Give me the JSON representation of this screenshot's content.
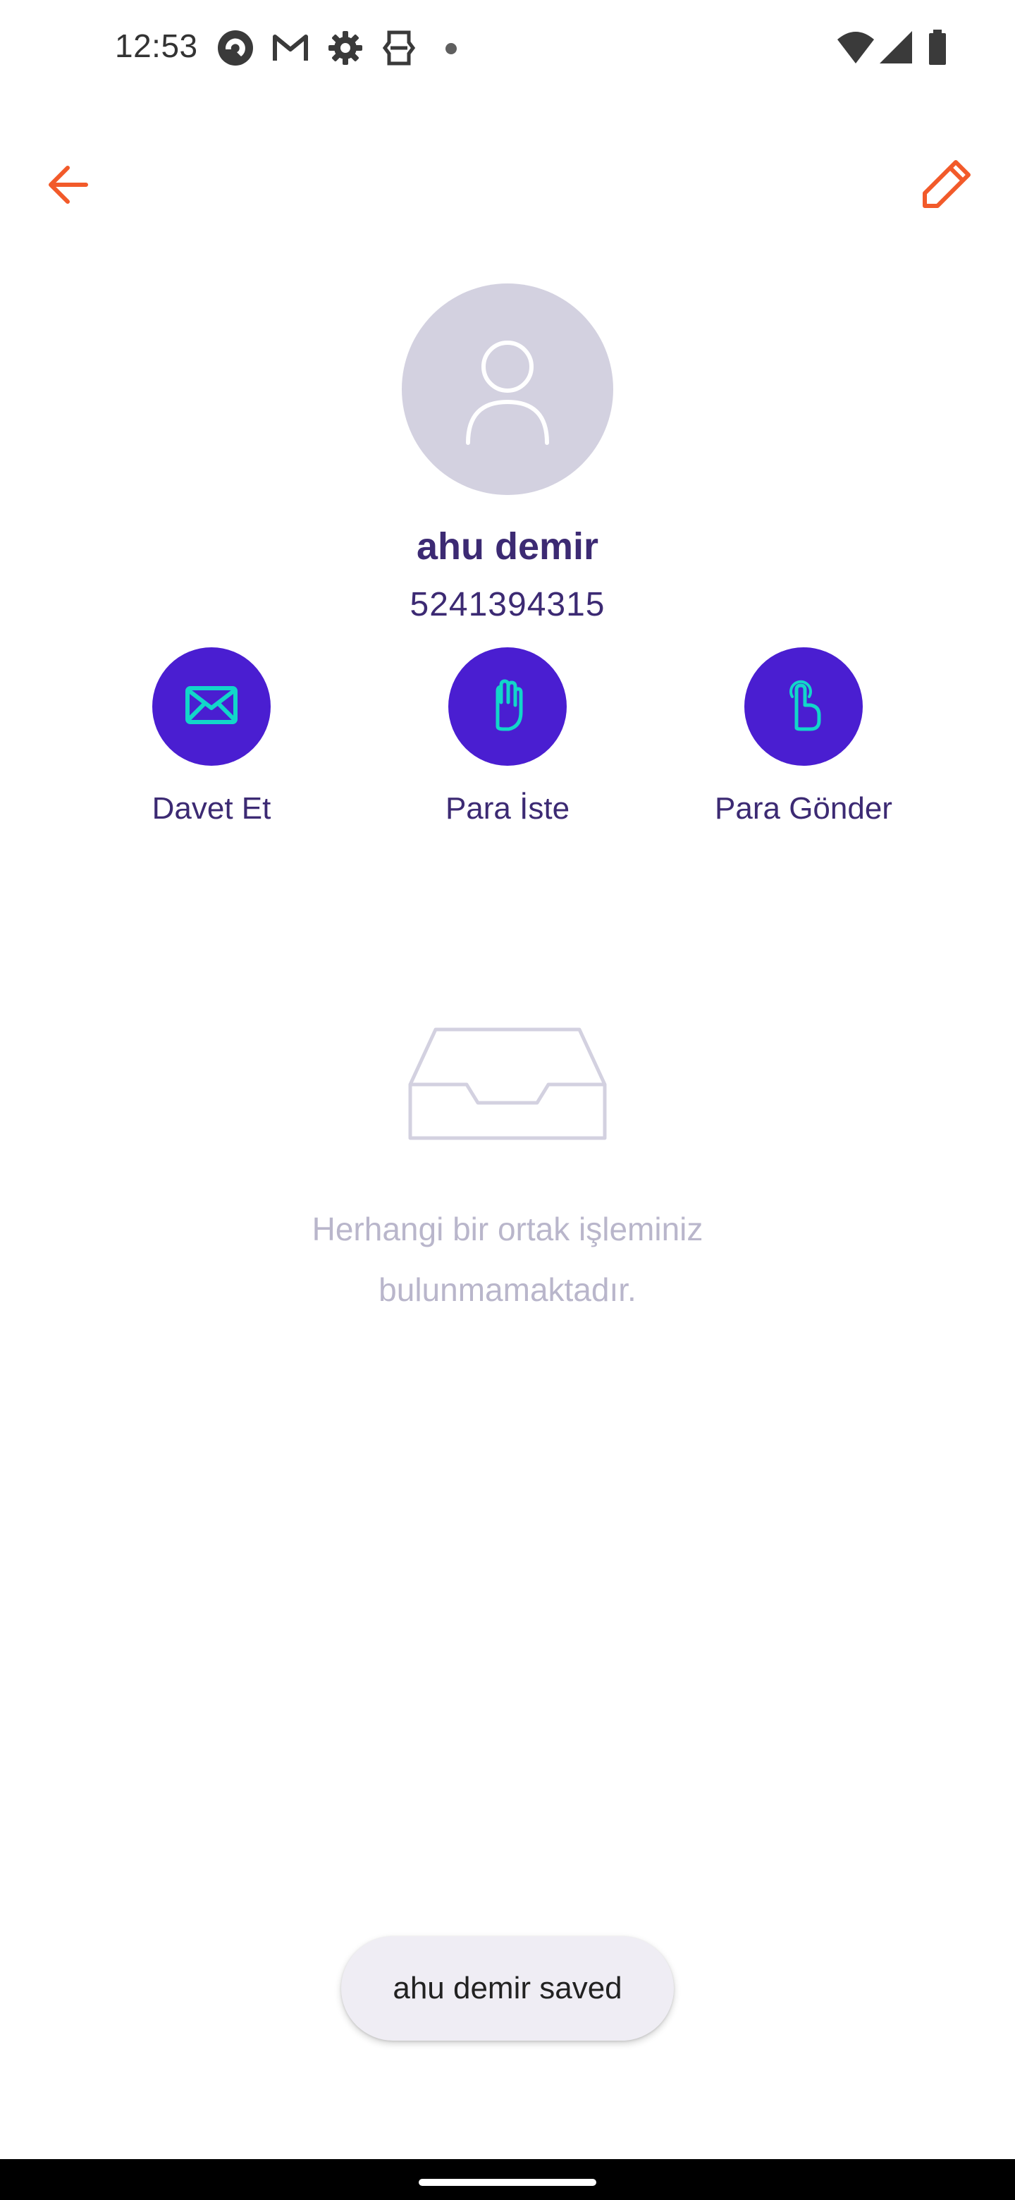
{
  "status_bar": {
    "time": "12:53",
    "icons": [
      "app-notification-icon",
      "gmail-icon",
      "settings-icon",
      "storage-icon",
      "dot-icon",
      "wifi-icon",
      "signal-icon",
      "battery-icon"
    ]
  },
  "app_bar": {
    "back_icon": "arrow-left-icon",
    "edit_icon": "pencil-icon",
    "accent_color": "#f25a2a"
  },
  "contact": {
    "name": "ahu demir",
    "phone": "5241394315",
    "avatar_icon": "person-icon"
  },
  "actions": [
    {
      "label": "Davet Et",
      "icon": "envelope-icon"
    },
    {
      "label": "Para İste",
      "icon": "hand-icon"
    },
    {
      "label": "Para Gönder",
      "icon": "tap-hand-icon"
    }
  ],
  "colors": {
    "primary": "#4a1ed1",
    "icon_accent": "#12d6c9",
    "text_primary": "#3c2a73",
    "text_muted": "#b9b6cb"
  },
  "empty_state": {
    "icon": "inbox-icon",
    "line1": "Herhangi bir ortak işleminiz",
    "line2": "bulunmamaktadır."
  },
  "snackbar": {
    "message": "ahu demir saved"
  }
}
